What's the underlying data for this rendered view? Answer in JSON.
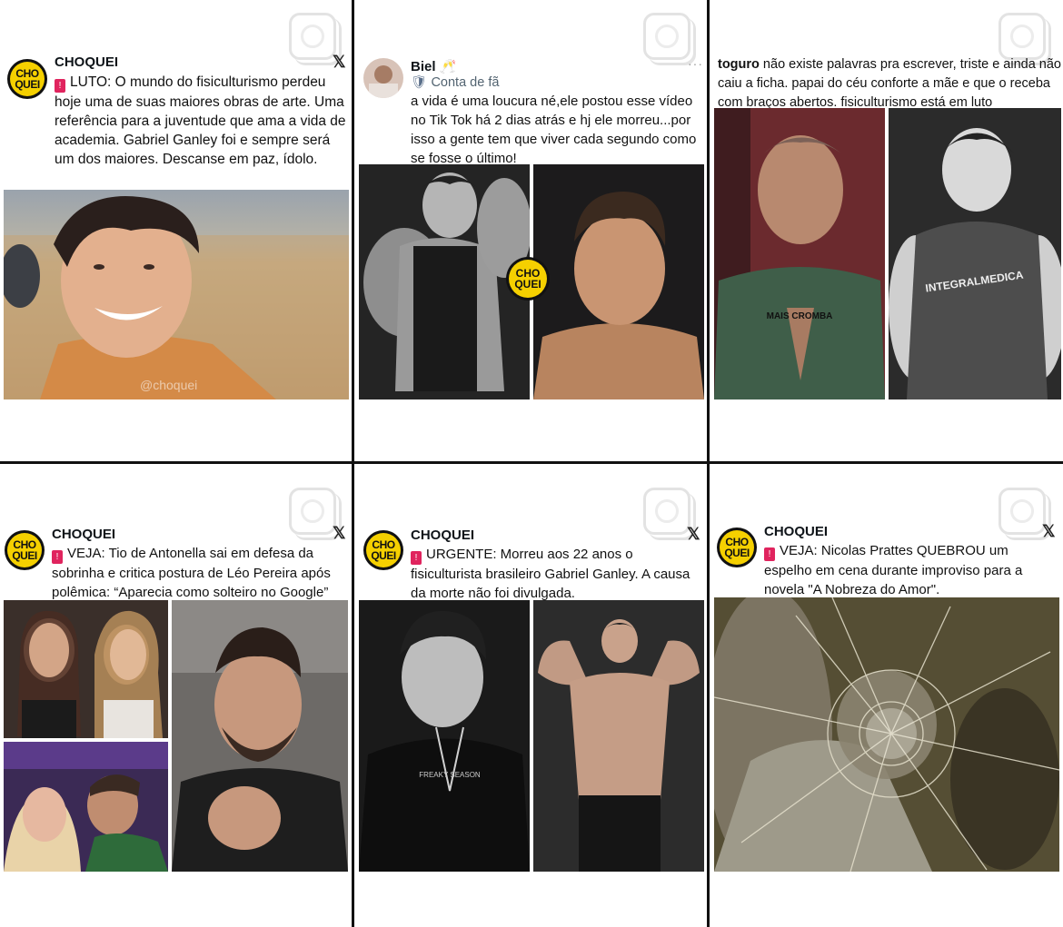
{
  "brand": {
    "logo_line1": "CHO",
    "logo_line2": "QUEI",
    "accent": "#f5d000"
  },
  "icons": {
    "share": "x-logo-icon",
    "instagram": "instagram-icon",
    "badge": "alert-badge-icon",
    "fan": "shield-icon"
  },
  "posts": [
    {
      "author": "CHOQUEI",
      "badge_tag": "LUTO:",
      "text": " O mundo do fisiculturismo perdeu hoje uma de suas maiores obras de arte. Uma referência para a juventude que ama a vida de academia. Gabriel Ganley foi e sempre será um dos maiores. Descanse em paz, ídolo.",
      "watermark": "@choquei",
      "x_label": "𝕏"
    },
    {
      "author": "Biel",
      "emoji": "🥂",
      "fan_label": "Conta de fã",
      "text": "a vida é uma loucura né,ele postou esse vídeo no Tik Tok há 2 dias atrás e hj ele morreu...por isso a gente tem que viver cada segundo como se fosse o último!",
      "menu": "···"
    },
    {
      "author": "toguro",
      "text": " não existe palavras pra escrever, triste e ainda não caiu a ficha. papai do céu conforte a mãe e que o receba com braços abertos. fisiculturismo está em luto",
      "shirt_text": "MAIS CROMBA",
      "tank_text": "INTEGRALMEDICA"
    },
    {
      "author": "CHOQUEI",
      "badge_tag": "VEJA:",
      "text": " Tio de Antonella sai em defesa da sobrinha e critica postura de Léo Pereira após polêmica: “Aparecia como solteiro no Google”",
      "x_label": "𝕏"
    },
    {
      "author": "CHOQUEI",
      "badge_tag": "URGENTE:",
      "text": " Morreu aos 22 anos o fisiculturista brasileiro Gabriel Ganley. A causa da morte não foi divulgada.",
      "shirt_text": "FREAKY SEASON",
      "x_label": "𝕏"
    },
    {
      "author": "CHOQUEI",
      "badge_tag": "VEJA:",
      "text": " Nicolas Prattes QUEBROU um espelho em cena durante improviso para a novela \"A Nobreza do Amor\".",
      "x_label": "𝕏"
    }
  ]
}
